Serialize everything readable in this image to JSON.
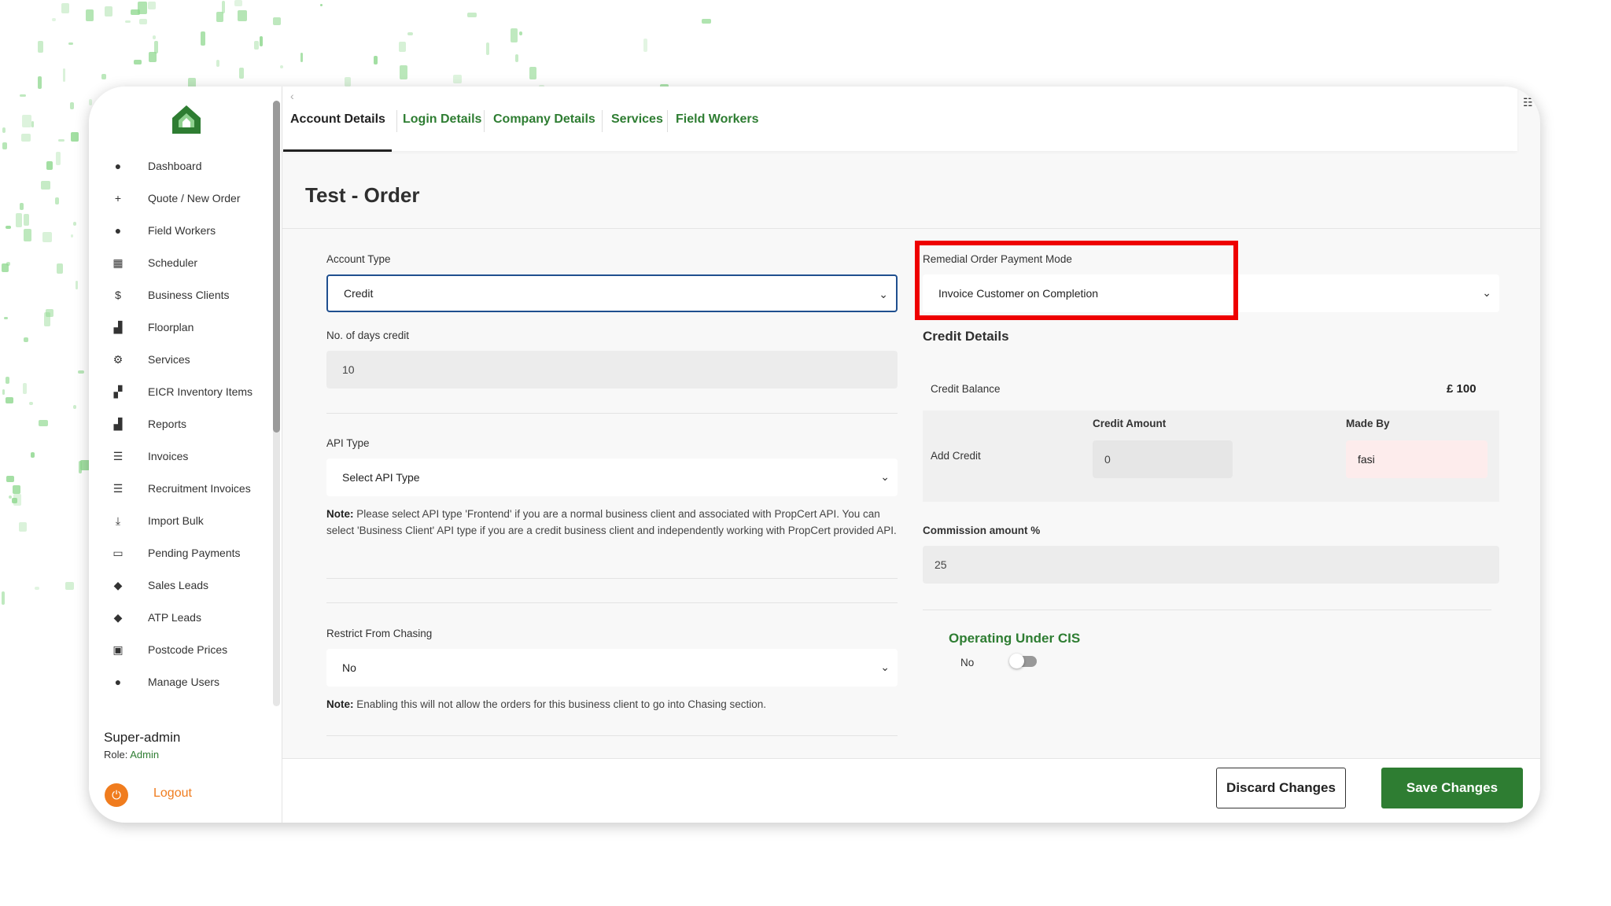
{
  "sidebar": {
    "items": [
      {
        "label": "Dashboard",
        "icon": "dashboard-gauge-icon",
        "glyph": "●"
      },
      {
        "label": "Quote / New Order",
        "icon": "plus-icon",
        "glyph": "+"
      },
      {
        "label": "Field Workers",
        "icon": "person-icon",
        "glyph": "●"
      },
      {
        "label": "Scheduler",
        "icon": "calendar-icon",
        "glyph": "▦"
      },
      {
        "label": "Business Clients",
        "icon": "dollar-icon",
        "glyph": "$"
      },
      {
        "label": "Floorplan",
        "icon": "bar-chart-icon",
        "glyph": "▟"
      },
      {
        "label": "Services",
        "icon": "gears-icon",
        "glyph": "⚙"
      },
      {
        "label": "EICR Inventory Items",
        "icon": "boxes-icon",
        "glyph": "▞"
      },
      {
        "label": "Reports",
        "icon": "chart-icon",
        "glyph": "▟"
      },
      {
        "label": "Invoices",
        "icon": "list-icon",
        "glyph": "☰"
      },
      {
        "label": "Recruitment Invoices",
        "icon": "list-icon",
        "glyph": "☰"
      },
      {
        "label": "Import Bulk",
        "icon": "download-icon",
        "glyph": "⤓"
      },
      {
        "label": "Pending Payments",
        "icon": "credit-card-icon",
        "glyph": "▭"
      },
      {
        "label": "Sales Leads",
        "icon": "tag-icon",
        "glyph": "◆"
      },
      {
        "label": "ATP Leads",
        "icon": "tag-icon",
        "glyph": "◆"
      },
      {
        "label": "Postcode Prices",
        "icon": "money-icon",
        "glyph": "▣"
      },
      {
        "label": "Manage Users",
        "icon": "user-icon",
        "glyph": "●"
      }
    ],
    "user_name": "Super-admin",
    "role_label": "Role:",
    "role_value": "Admin",
    "logout": "Logout"
  },
  "tabs": [
    "Account Details",
    "Login Details",
    "Company Details",
    "Services",
    "Field Workers"
  ],
  "active_tab": "Account Details",
  "page_title": "Test - Order",
  "form": {
    "account_type_label": "Account Type",
    "account_type_value": "Credit",
    "days_credit_label": "No. of days credit",
    "days_credit_value": "10",
    "api_type_label": "API Type",
    "api_type_value": "Select API Type",
    "api_note_bold": "Note:",
    "api_note_text": " Please select API type 'Frontend' if you are a normal business client and associated with PropCert API. You can select 'Business Client' API type if you are a credit business client and independently working with PropCert provided API.",
    "restrict_label": "Restrict From Chasing",
    "restrict_value": "No",
    "restrict_note_bold": "Note:",
    "restrict_note_text": " Enabling this will not allow the orders for this business client to go into Chasing section.",
    "payment_mode_label": "Remedial Order Payment Mode",
    "payment_mode_value": "Invoice Customer on Completion",
    "credit_details_title": "Credit Details",
    "credit_balance_label": "Credit Balance",
    "credit_balance_value": "£ 100",
    "add_credit_label": "Add Credit",
    "credit_amount_label": "Credit Amount",
    "credit_amount_value": "0",
    "made_by_label": "Made By",
    "made_by_value": "fasi",
    "commission_label": "Commission amount %",
    "commission_value": "25",
    "cis_title": "Operating Under CIS",
    "cis_value": "No"
  },
  "footer": {
    "discard": "Discard Changes",
    "save": "Save Changes"
  },
  "colors": {
    "accent": "#2e7d32",
    "highlight": "#e00000",
    "logout": "#f07c1e"
  }
}
